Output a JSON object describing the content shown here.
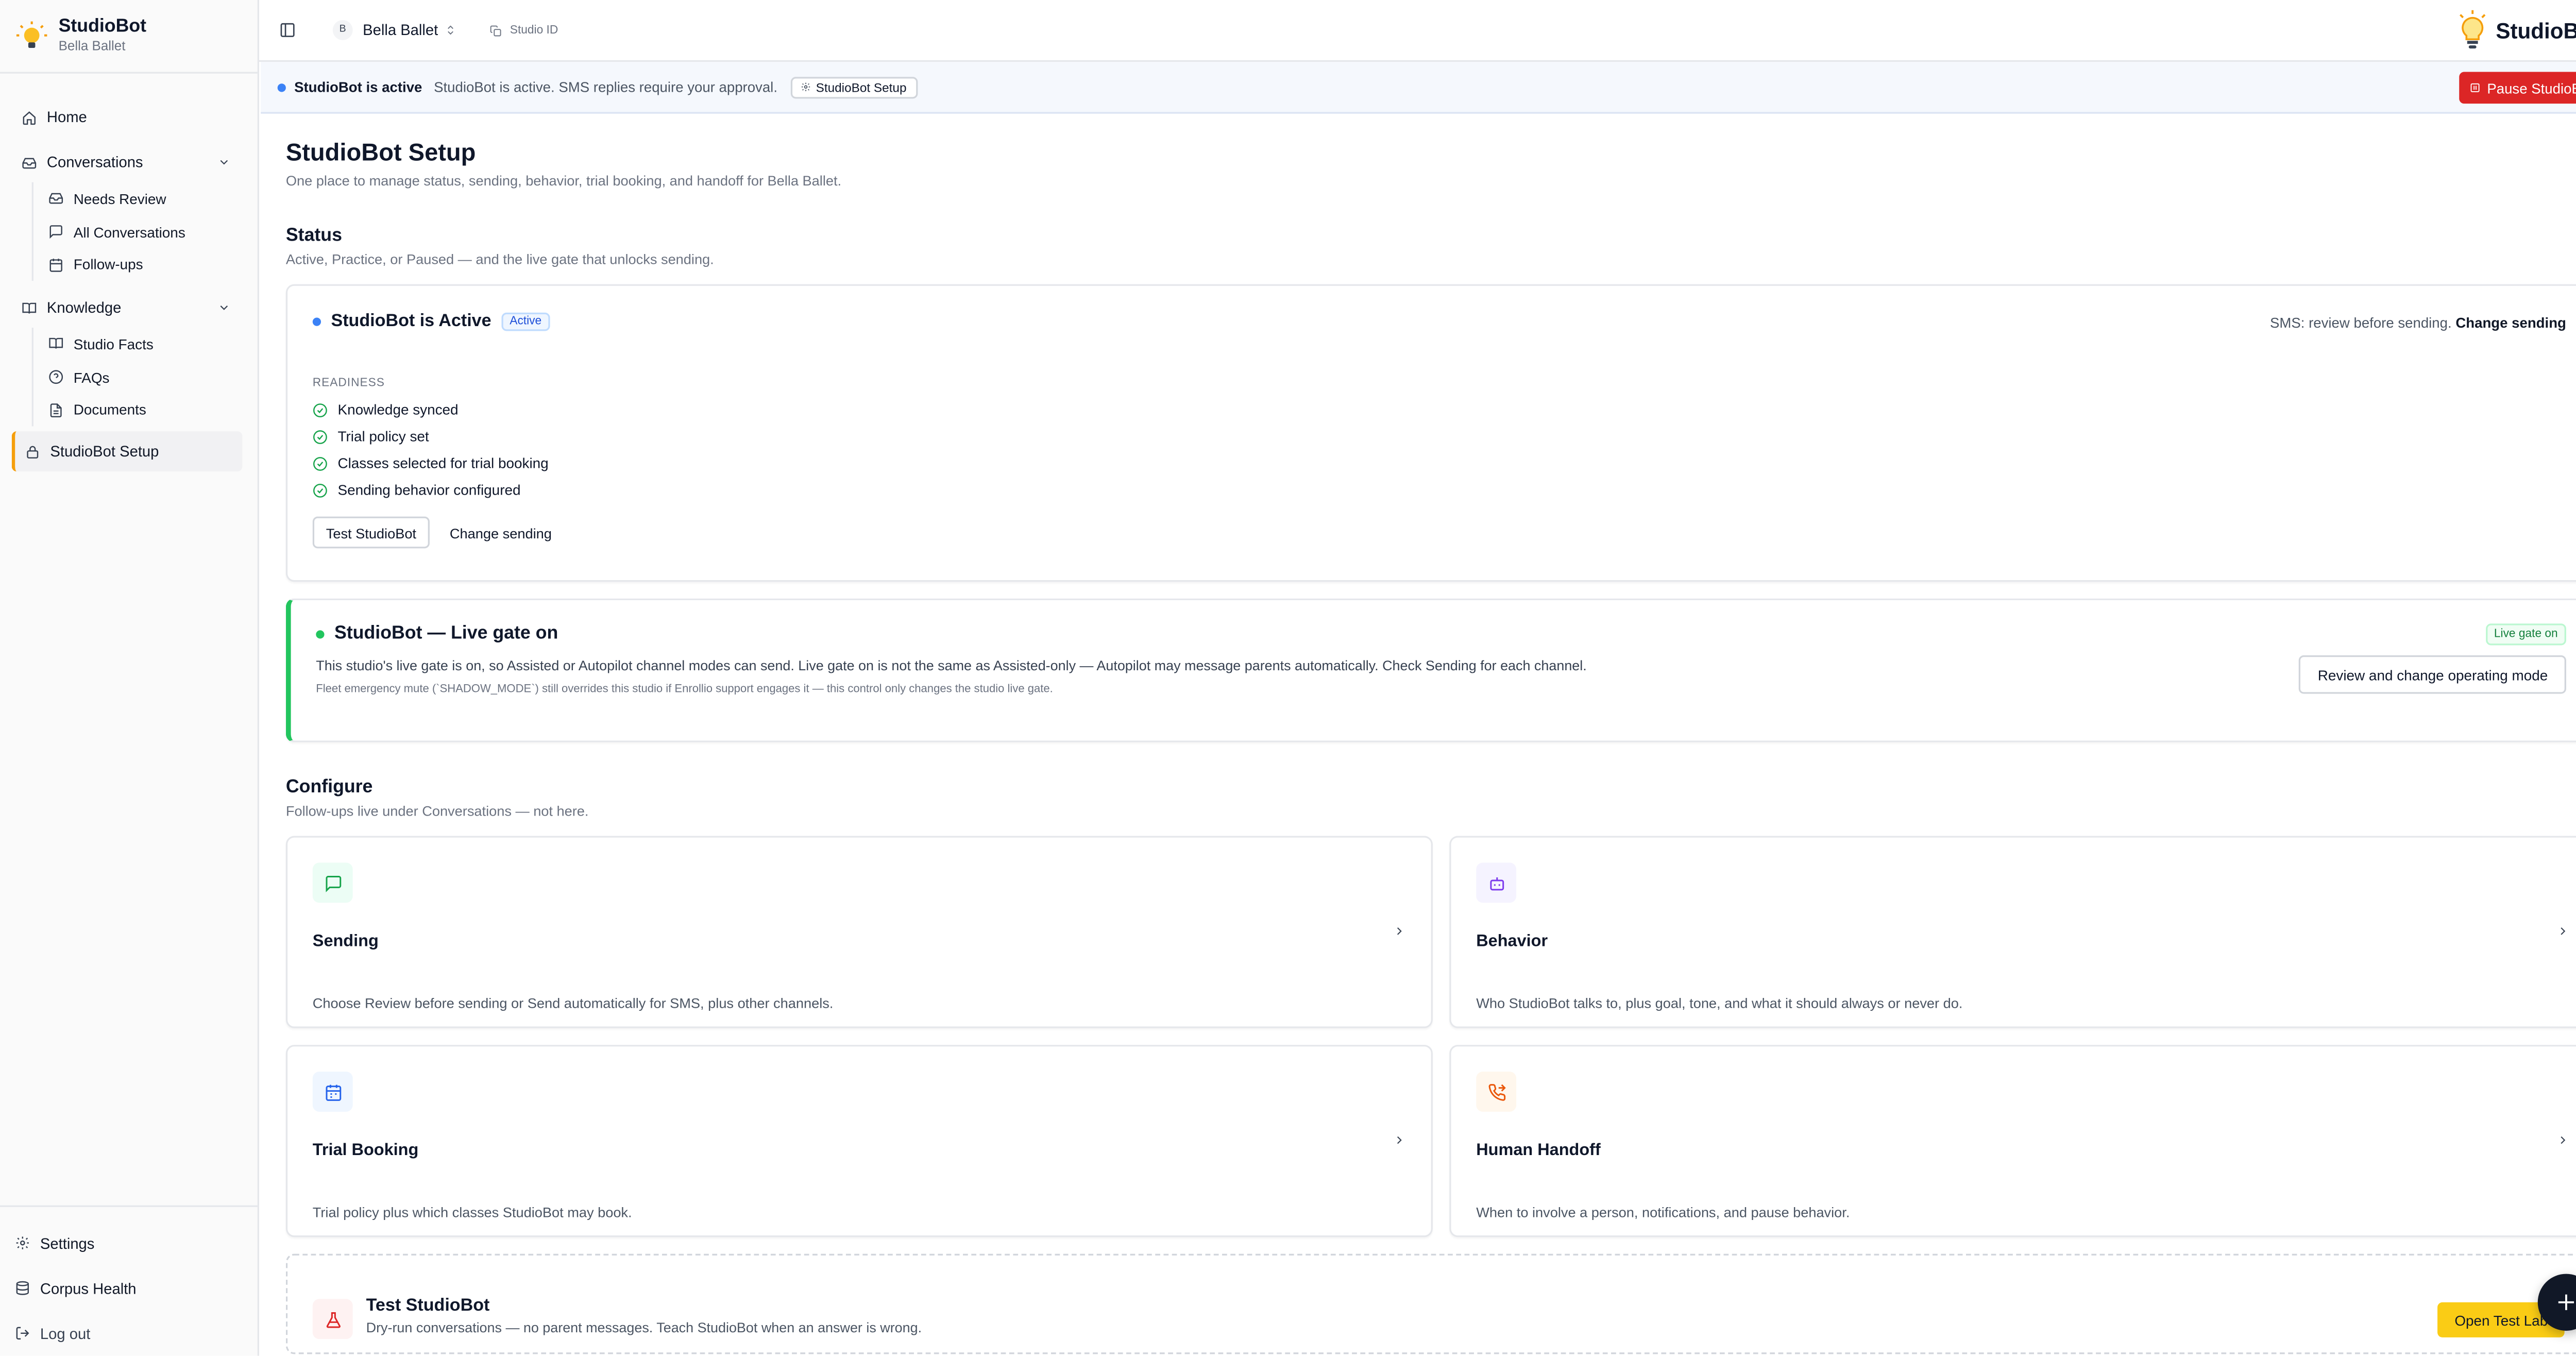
{
  "app": {
    "name": "StudioBot",
    "studio": "Bella Ballet",
    "avatar_initial": "B",
    "studio_id_label": "Studio ID",
    "top_brand": "StudioBot"
  },
  "sidebar": {
    "home": "Home",
    "conversations": "Conversations",
    "conversations_items": [
      "Needs Review",
      "All Conversations",
      "Follow-ups"
    ],
    "knowledge": "Knowledge",
    "knowledge_items": [
      "Studio Facts",
      "FAQs",
      "Documents"
    ],
    "setup": "StudioBot Setup",
    "bottom": [
      "Settings",
      "Corpus Health",
      "Log out"
    ]
  },
  "banner": {
    "status": "StudioBot is active",
    "text": "StudioBot is active. SMS replies require your approval.",
    "chip": "StudioBot Setup",
    "pause_button": "Pause StudioBot",
    "dot_color": "#3b82f6"
  },
  "page": {
    "title": "StudioBot Setup",
    "subtitle": "One place to manage status, sending, behavior, trial booking, and handoff for Bella Ballet."
  },
  "status": {
    "heading": "Status",
    "subheading": "Active, Practice, or Paused — and the live gate that unlocks sending.",
    "card_title": "StudioBot is Active",
    "badge": "Active",
    "right_text": "SMS: review before sending.",
    "right_link": "Change sending",
    "readiness_label": "READINESS",
    "readiness_items": [
      "Knowledge synced",
      "Trial policy set",
      "Classes selected for trial booking",
      "Sending behavior configured"
    ],
    "test_button": "Test StudioBot",
    "change_button": "Change sending"
  },
  "gate": {
    "title": "StudioBot — Live gate on",
    "badge": "Live gate on",
    "text": "This studio's live gate is on, so Assisted or Autopilot channel modes can send. Live gate on is not the same as Assisted-only — Autopilot may message parents automatically. Check Sending for each channel.",
    "note": "Fleet emergency mute (`SHADOW_MODE`) still overrides this studio if Enrollio support engages it — this control only changes the studio live gate.",
    "button": "Review and change operating mode",
    "dot_color": "#22c55e"
  },
  "configure": {
    "heading": "Configure",
    "subheading": "Follow-ups live under Conversations — not here.",
    "cards": [
      {
        "title": "Sending",
        "desc": "Choose Review before sending or Send automatically for SMS, plus other channels.",
        "icon": "message-square-icon",
        "bg": "#ecfdf5",
        "stroke": "#16a34a"
      },
      {
        "title": "Behavior",
        "desc": "Who StudioBot talks to, plus goal, tone, and what it should always or never do.",
        "icon": "bot-icon",
        "bg": "#f5f3ff",
        "stroke": "#7c3aed"
      },
      {
        "title": "Trial Booking",
        "desc": "Trial policy plus which classes StudioBot may book.",
        "icon": "calendar-icon",
        "bg": "#eff6ff",
        "stroke": "#2563eb"
      },
      {
        "title": "Human Handoff",
        "desc": "When to involve a person, notifications, and pause behavior.",
        "icon": "phone-forward-icon",
        "bg": "#fff7ed",
        "stroke": "#ea580c"
      }
    ]
  },
  "test": {
    "title": "Test StudioBot",
    "desc": "Dry-run conversations — no parent messages. Teach StudioBot when an answer is wrong.",
    "button": "Open Test Lab"
  }
}
